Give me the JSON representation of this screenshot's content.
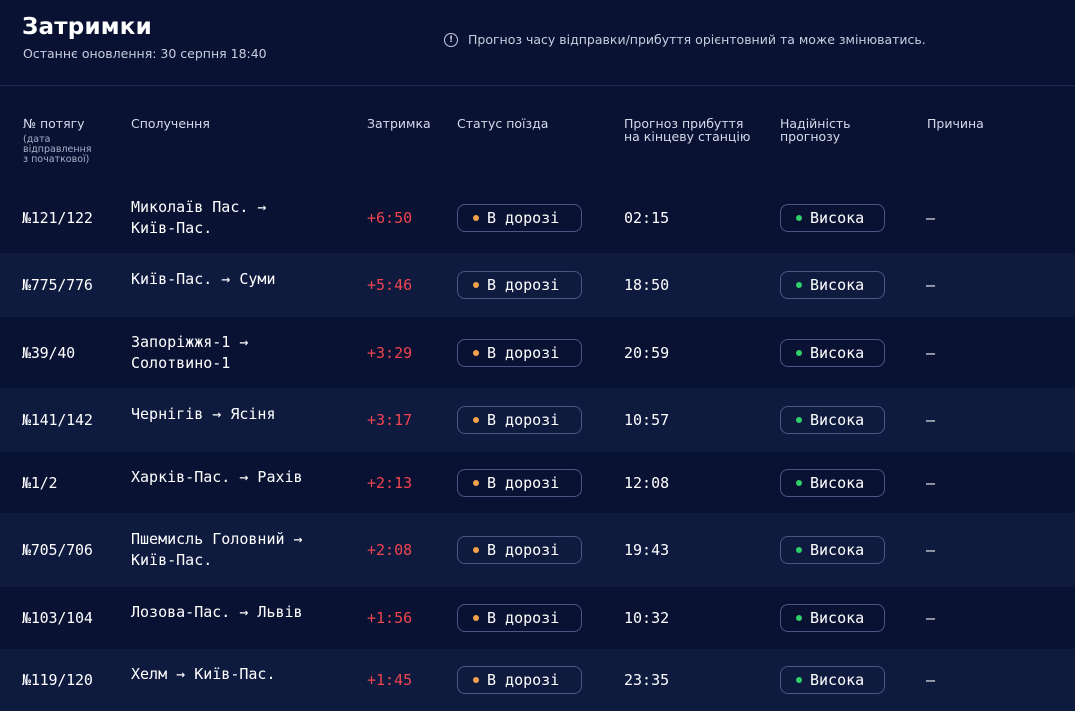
{
  "header": {
    "title": "Затримки",
    "last_update": "Останнє оновлення: 30 серпня 18:40",
    "notice": "Прогноз часу відправки/прибуття орієнтовний та може змінюватись."
  },
  "columns": {
    "train": "№ потягу",
    "train_sub": "(дата відправлення з початкової)",
    "route": "Сполучення",
    "delay": "Затримка",
    "status": "Статус поїзда",
    "arrival": "Прогноз прибуття на кінцеву станцію",
    "reliability": "Надійність прогнозу",
    "reason": "Причина"
  },
  "colors": {
    "background": "#0a1233",
    "row_alt": "#0f1a3f",
    "delay": "#f0454f",
    "status_dot": "#f5a04a",
    "reliability_dot": "#2fd06a"
  },
  "rows": [
    {
      "train": "№121/122",
      "route_line1": "Миколаїв Пас. →",
      "route_line2": "Київ-Пас.",
      "delay": "+6:50",
      "status": "В дорозі",
      "arrival": "02:15",
      "reliability": "Висока",
      "reason": "—"
    },
    {
      "train": "№775/776",
      "route_line1": "Київ-Пас. → Суми",
      "route_line2": "",
      "delay": "+5:46",
      "status": "В дорозі",
      "arrival": "18:50",
      "reliability": "Висока",
      "reason": "—"
    },
    {
      "train": "№39/40",
      "route_line1": "Запоріжжя-1 →",
      "route_line2": "Солотвино-1",
      "delay": "+3:29",
      "status": "В дорозі",
      "arrival": "20:59",
      "reliability": "Висока",
      "reason": "—"
    },
    {
      "train": "№141/142",
      "route_line1": "Чернігів → Ясіня",
      "route_line2": "",
      "delay": "+3:17",
      "status": "В дорозі",
      "arrival": "10:57",
      "reliability": "Висока",
      "reason": "—"
    },
    {
      "train": "№1/2",
      "route_line1": "Харків-Пас. → Рахів",
      "route_line2": "",
      "delay": "+2:13",
      "status": "В дорозі",
      "arrival": "12:08",
      "reliability": "Висока",
      "reason": "—"
    },
    {
      "train": "№705/706",
      "route_line1": "Пшемисль Головний →",
      "route_line2": "Київ-Пас.",
      "delay": "+2:08",
      "status": "В дорозі",
      "arrival": "19:43",
      "reliability": "Висока",
      "reason": "—"
    },
    {
      "train": "№103/104",
      "route_line1": "Лозова-Пас. → Львів",
      "route_line2": "",
      "delay": "+1:56",
      "status": "В дорозі",
      "arrival": "10:32",
      "reliability": "Висока",
      "reason": "—"
    },
    {
      "train": "№119/120",
      "route_line1": "Хелм → Київ-Пас.",
      "route_line2": "",
      "delay": "+1:45",
      "status": "В дорозі",
      "arrival": "23:35",
      "reliability": "Висока",
      "reason": "—"
    }
  ]
}
